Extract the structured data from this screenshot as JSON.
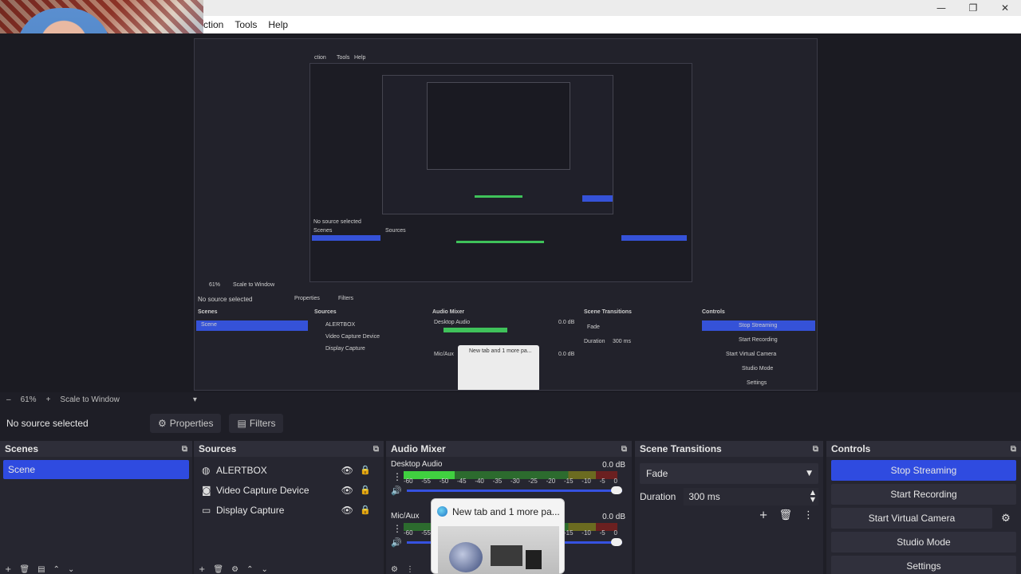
{
  "window": {
    "minimize_glyph": "—",
    "restore_glyph": "❐",
    "close_glyph": "✕"
  },
  "menu": {
    "items": [
      "ction",
      "Tools",
      "Help"
    ]
  },
  "zoom": {
    "minus": "–",
    "value": "61%",
    "plus": "+",
    "mode": "Scale to Window",
    "arrow": "▾"
  },
  "props": {
    "status": "No source selected",
    "properties_label": "Properties",
    "filters_label": "Filters"
  },
  "scenes": {
    "title": "Scenes",
    "items": [
      "Scene"
    ]
  },
  "sources": {
    "title": "Sources",
    "items": [
      {
        "name": "ALERTBOX",
        "icon": "browser-icon"
      },
      {
        "name": "Video Capture Device",
        "icon": "camera-icon"
      },
      {
        "name": "Display Capture",
        "icon": "monitor-icon"
      }
    ]
  },
  "mixer": {
    "title": "Audio Mixer",
    "scale": [
      "-60",
      "-55",
      "-50",
      "-45",
      "-40",
      "-35",
      "-30",
      "-25",
      "-20",
      "-15",
      "-10",
      "-5",
      "0"
    ],
    "channels": [
      {
        "name": "Desktop Audio",
        "db": "0.0 dB",
        "level": 0.24
      },
      {
        "name": "Mic/Aux",
        "db": "0.0 dB",
        "level": 0.0
      }
    ]
  },
  "tooltip": {
    "title": "New tab and 1 more pa..."
  },
  "transitions": {
    "title": "Scene Transitions",
    "selected": "Fade",
    "duration_label": "Duration",
    "duration_value": "300 ms"
  },
  "controls": {
    "title": "Controls",
    "stop_streaming": "Stop Streaming",
    "start_recording": "Start Recording",
    "start_virtual_camera": "Start Virtual Camera",
    "studio_mode": "Studio Mode",
    "settings": "Settings"
  },
  "nested_preview": {
    "menu": [
      "ction",
      "Tools",
      "Help"
    ],
    "status": "No source selected",
    "properties_label": "Properties",
    "filters_label": "Filters",
    "zoom_value": "61%",
    "zoom_mode": "Scale to Window",
    "scenes_title": "Scenes",
    "scene": "Scene",
    "sources_title": "Sources",
    "sources": [
      "ALERTBOX",
      "Video Capture Device",
      "Display Capture"
    ],
    "mixer_title": "Audio Mixer",
    "desktop_audio": "Desktop Audio",
    "mic": "Mic/Aux",
    "db": "0.0 dB",
    "transitions_title": "Scene Transitions",
    "fade": "Fade",
    "duration": "Duration",
    "duration_value": "300 ms",
    "controls_title": "Controls",
    "stop_streaming": "Stop Streaming",
    "start_recording": "Start Recording",
    "start_virtual_camera": "Start Virtual Camera",
    "studio_mode": "Studio Mode",
    "settings": "Settings",
    "tooltip": "New tab and 1 more pa..."
  },
  "colors": {
    "accent": "#2f4be0",
    "meter_green": "#40d040",
    "panel_bg": "#262630",
    "app_bg": "#1e1e26"
  }
}
